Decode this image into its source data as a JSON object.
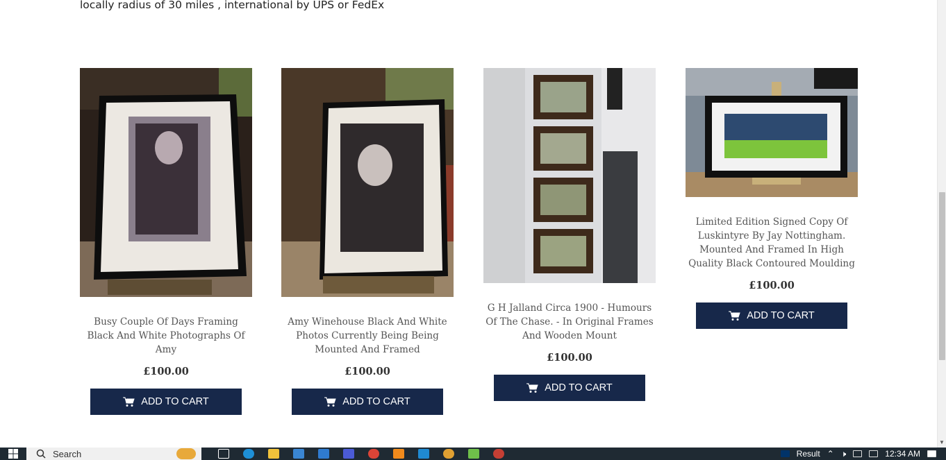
{
  "shipping_text": "locally radius of 30 miles , international by UPS or FedEx",
  "products": [
    {
      "title": "Busy Couple Of Days Framing Black And White Photographs Of Amy",
      "price": "£100.00",
      "button_label": "ADD TO CART"
    },
    {
      "title": "Amy Winehouse Black And White Photos Currently Being Being Mounted And Framed",
      "price": "£100.00",
      "button_label": "ADD TO CART"
    },
    {
      "title": "G H Jalland Circa 1900 - Humours Of The Chase. - In Original Frames And Wooden Mount",
      "price": "£100.00",
      "button_label": "ADD TO CART"
    },
    {
      "title": "Limited Edition Signed Copy Of Luskintyre By Jay Nottingham. Mounted And Framed In High Quality Black Contoured Moulding",
      "price": "£100.00",
      "button_label": "ADD TO CART"
    }
  ],
  "colors": {
    "button_bg": "#17284a",
    "taskbar_bg": "#1f2a33"
  },
  "taskbar": {
    "search_placeholder": "Search",
    "tray_label": "Result",
    "clock": "12:34 AM"
  }
}
